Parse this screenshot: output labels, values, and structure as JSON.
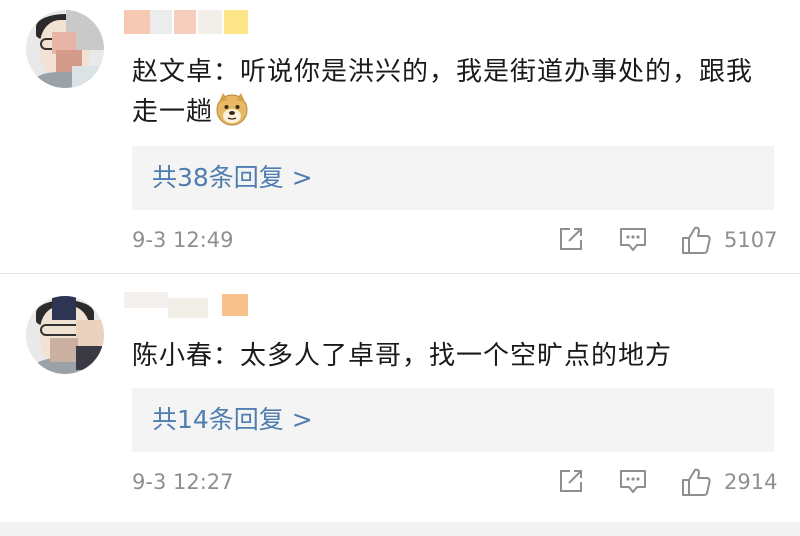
{
  "comments": [
    {
      "text": "赵文卓：听说你是洪兴的，我是街道办事处的，跟我走一趟",
      "emoji": "doge-icon",
      "replies_label": "共38条回复 >",
      "timestamp": "9-3 12:49",
      "likes": "5107"
    },
    {
      "text": "陈小春：太多人了卓哥，找一个空旷点的地方",
      "replies_label": "共14条回复 >",
      "timestamp": "9-3 12:27",
      "likes": "2914"
    }
  ],
  "colors": {
    "link": "#507daf",
    "meta": "#8f8f8f",
    "reply_bg": "#f4f4f4"
  }
}
